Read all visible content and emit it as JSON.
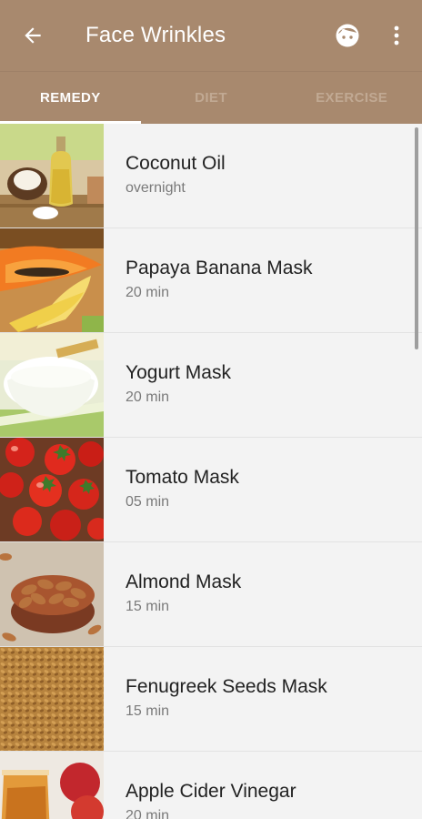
{
  "appbar": {
    "title": "Face Wrinkles",
    "back_icon": "arrow-back-icon",
    "face_icon": "face-icon",
    "more_icon": "more-vert-icon",
    "color": "#a8896e"
  },
  "tabs": [
    {
      "label": "REMEDY",
      "active": true
    },
    {
      "label": "DIET",
      "active": false
    },
    {
      "label": "EXERCISE",
      "active": false
    }
  ],
  "remedies": [
    {
      "title": "Coconut Oil",
      "duration": "overnight",
      "image": "coconut-oil-image"
    },
    {
      "title": "Papaya Banana Mask",
      "duration": "20 min",
      "image": "papaya-banana-image"
    },
    {
      "title": "Yogurt Mask",
      "duration": "20 min",
      "image": "yogurt-image"
    },
    {
      "title": "Tomato Mask",
      "duration": "05 min",
      "image": "tomato-image"
    },
    {
      "title": "Almond Mask",
      "duration": "15 min",
      "image": "almond-image"
    },
    {
      "title": "Fenugreek Seeds Mask",
      "duration": "15 min",
      "image": "fenugreek-image"
    },
    {
      "title": "Apple Cider Vinegar",
      "duration": "20 min",
      "image": "apple-cider-image"
    }
  ]
}
